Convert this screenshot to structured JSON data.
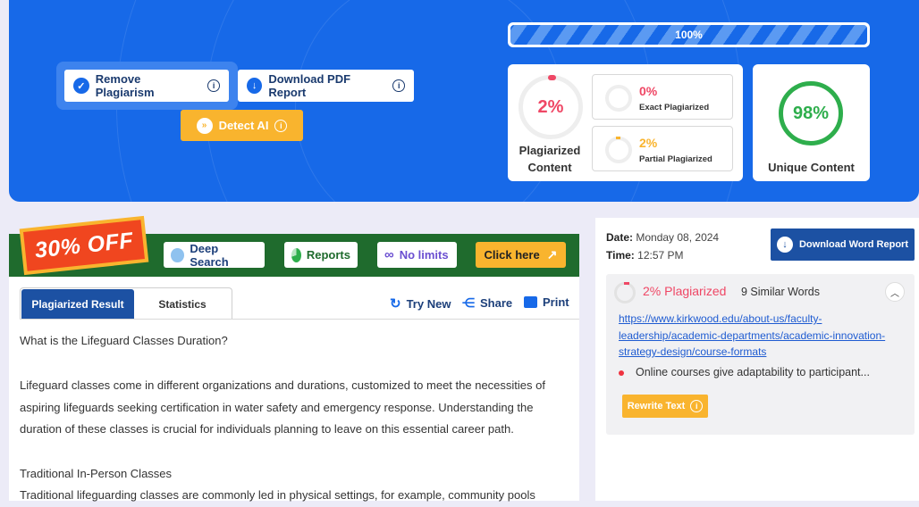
{
  "toolbar": {
    "remove_plagiarism": "Remove Plagiarism",
    "download_pdf": "Download PDF Report",
    "detect_ai": "Detect AI"
  },
  "progress": {
    "label": "100%",
    "value": 100
  },
  "stats": {
    "plagiarized_pct": "2%",
    "plagiarized_label": "Plagiarized Content",
    "exact_pct": "0%",
    "exact_label": "Exact Plagiarized",
    "partial_pct": "2%",
    "partial_label": "Partial Plagiarized",
    "unique_pct": "98%",
    "unique_label": "Unique Content"
  },
  "colors": {
    "brand_blue": "#1769e8",
    "red": "#ef4765",
    "orange": "#f9b42e",
    "green": "#2eae4c",
    "navy": "#1c51a3"
  },
  "promo": {
    "badge": "30% OFF",
    "deep_search": "Deep Search",
    "reports": "Reports",
    "no_limits": "No limits",
    "click_here": "Click here"
  },
  "tabs": {
    "active": "Plagiarized Result",
    "inactive": "Statistics"
  },
  "actions": {
    "try_new": "Try New",
    "share": "Share",
    "print": "Print"
  },
  "content": {
    "p1": "What is the Lifeguard Classes Duration?",
    "p2": "Lifeguard classes come in different organizations and durations, customized to meet the necessities of aspiring lifeguards seeking certification in water safety and emergency response. Understanding the duration of these classes is crucial for individuals planning to leave on this essential career path.",
    "p3": "Traditional In-Person Classes",
    "p4": "Traditional lifeguarding classes are commonly led in physical settings, for example, community pools"
  },
  "report": {
    "date_label": "Date:",
    "date_value": "Monday 08, 2024",
    "time_label": "Time:",
    "time_value": "12:57 PM",
    "download_word": "Download Word Report",
    "result_pct": "2% Plagiarized",
    "similar_words": "9 Similar Words",
    "source_url": "https://www.kirkwood.edu/about-us/faculty-leadership/academic-departments/academic-innovation-strategy-design/course-formats",
    "matched_sentence": "Online courses give adaptability to participant...",
    "rewrite": "Rewrite Text"
  },
  "icons": {
    "remove_plagiarism": "check-circle-icon",
    "download_pdf": "download-circle-icon",
    "info": "info-icon",
    "detect_ai": "double-chevron-icon",
    "deep_search": "search-icon",
    "reports": "pie-chart-icon",
    "no_limits": "infinity-icon",
    "click_here": "arrow-up-right-icon",
    "try_new": "refresh-icon",
    "share": "share-icon",
    "print": "printer-icon",
    "collapse": "chevron-up-icon"
  }
}
